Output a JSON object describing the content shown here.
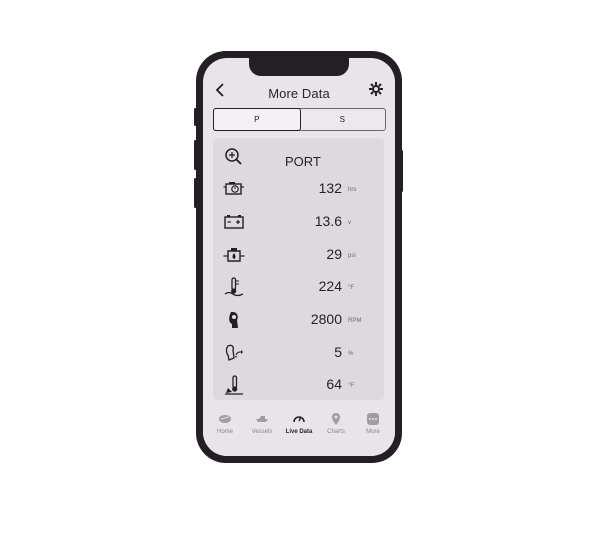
{
  "header": {
    "title": "More Data",
    "back_icon": "chevron-left-icon",
    "settings_icon": "gear-icon"
  },
  "segments": [
    {
      "label": "P",
      "selected": true
    },
    {
      "label": "S",
      "selected": false
    }
  ],
  "panel": {
    "title": "PORT",
    "rows": [
      {
        "icon": "engine-hours-icon",
        "value": "132",
        "unit": "hrs"
      },
      {
        "icon": "battery-icon",
        "value": "13.6",
        "unit": "v"
      },
      {
        "icon": "oil-pressure-icon",
        "value": "29",
        "unit": "psi"
      },
      {
        "icon": "oil-temperature-icon",
        "value": "224",
        "unit": "°F"
      },
      {
        "icon": "engine-rpm-icon",
        "value": "2800",
        "unit": "RPM"
      },
      {
        "icon": "trim-icon",
        "value": "5",
        "unit": "%"
      },
      {
        "icon": "coolant-temperature-icon",
        "value": "64",
        "unit": "°F"
      }
    ]
  },
  "tabbar": [
    {
      "label": "Home",
      "icon": "home-icon",
      "active": false
    },
    {
      "label": "Vessels",
      "icon": "vessels-icon",
      "active": false
    },
    {
      "label": "Live Data",
      "icon": "gauge-icon",
      "active": true
    },
    {
      "label": "Charts",
      "icon": "location-pin-icon",
      "active": false
    },
    {
      "label": "More",
      "icon": "more-icon",
      "active": false
    }
  ]
}
